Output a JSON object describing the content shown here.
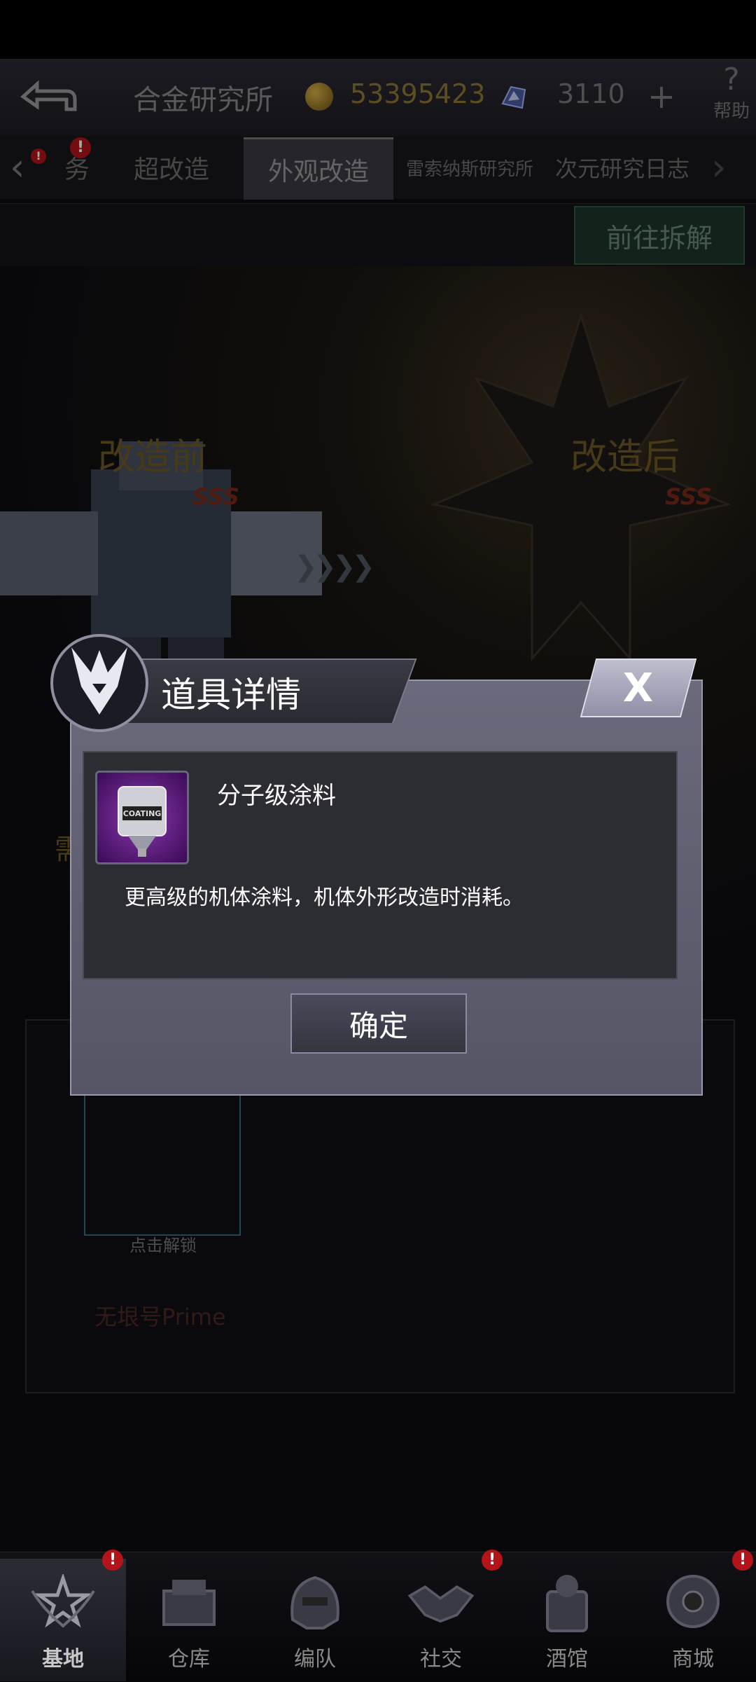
{
  "header": {
    "title": "合金研究所",
    "coins": "53395423",
    "gems": "3110",
    "plus": "+",
    "help_symbol": "?",
    "help_label": "帮助"
  },
  "tabs": [
    {
      "label": "务",
      "badge": "!"
    },
    {
      "label": "超改造"
    },
    {
      "label": "外观改造"
    },
    {
      "label": "雷索纳斯研究所"
    },
    {
      "label": "次元研究日志"
    }
  ],
  "tabs_left_badge": "!",
  "dismantle_label": "前往拆解",
  "scene": {
    "before_label": "改造前",
    "after_label": "改造后",
    "rank_before": "SSS",
    "rank_after": "SSS",
    "arrows": "❯❯❯❯",
    "left_partial_text": "需",
    "unlock_text": "点击解锁",
    "prime_name": "无垠号Prime"
  },
  "modal": {
    "title": "道具详情",
    "close": "X",
    "item_label": "COATING",
    "item_name": "分子级涂料",
    "item_desc": "更高级的机体涂料，机体外形改造时消耗。",
    "confirm": "确定"
  },
  "bottom_nav": [
    {
      "label": "基地",
      "icon": "star-badge-icon",
      "badge": "!"
    },
    {
      "label": "仓库",
      "icon": "crate-icon"
    },
    {
      "label": "编队",
      "icon": "helmet-icon"
    },
    {
      "label": "社交",
      "icon": "handshake-icon",
      "badge": "!"
    },
    {
      "label": "酒馆",
      "icon": "tavern-icon"
    },
    {
      "label": "商城",
      "icon": "shop-icon",
      "badge": "!"
    }
  ]
}
